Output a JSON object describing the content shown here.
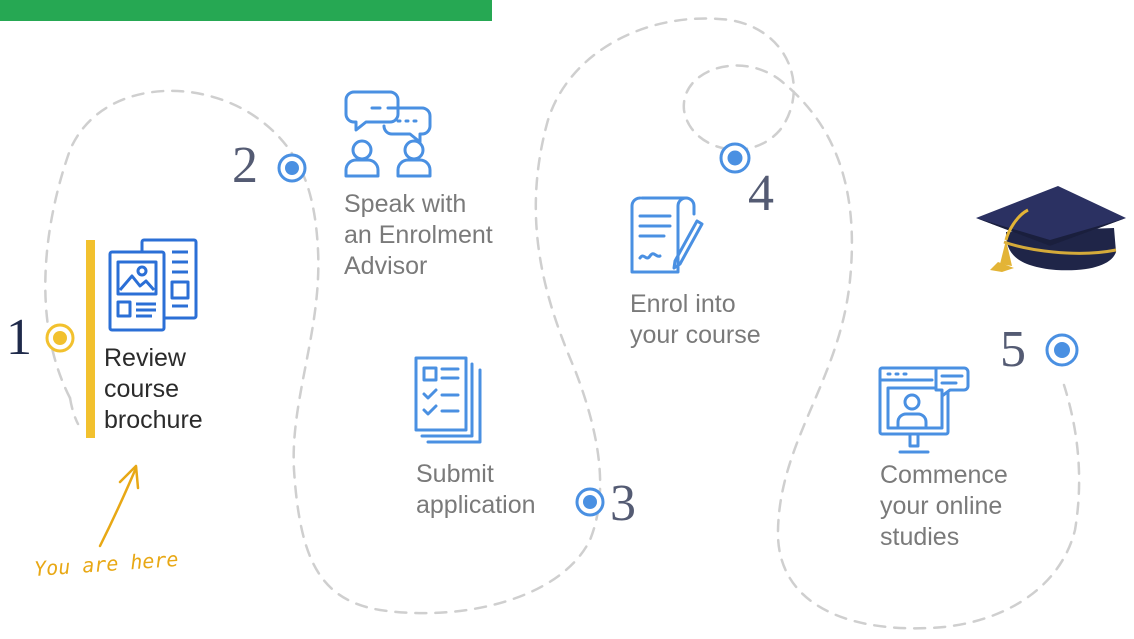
{
  "steps": [
    {
      "number": "1",
      "label": [
        "Review",
        "course",
        "brochure"
      ],
      "state": "current"
    },
    {
      "number": "2",
      "label": [
        "Speak with",
        "an Enrolment",
        "Advisor"
      ],
      "state": "upcoming"
    },
    {
      "number": "3",
      "label": [
        "Submit",
        "application"
      ],
      "state": "upcoming"
    },
    {
      "number": "4",
      "label": [
        "Enrol into",
        "your course"
      ],
      "state": "upcoming"
    },
    {
      "number": "5",
      "label": [
        "Commence",
        "your online",
        "studies"
      ],
      "state": "upcoming"
    }
  ],
  "current_marker": {
    "text": "You are here"
  },
  "icons": {
    "step1": "brochure-icon",
    "step2": "chat-advisors-icon",
    "step3": "application-form-icon",
    "step4": "signed-document-icon",
    "step5": "online-class-icon",
    "finish": "graduation-cap-icon"
  },
  "colors": {
    "top_bar": "#26a853",
    "active_accent": "#f2c12e",
    "step_dot": "#4a90e2",
    "icon_blue": "#4a90e2",
    "path_dash": "#cfcfcf"
  }
}
